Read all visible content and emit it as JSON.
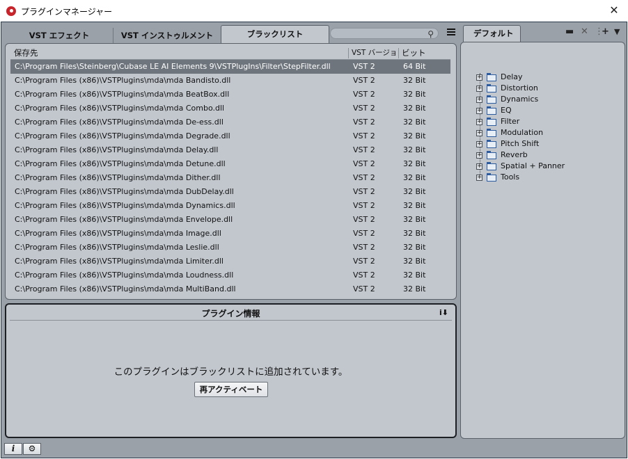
{
  "window": {
    "title": "プラグインマネージャー",
    "close_icon": "close-icon"
  },
  "tabs": [
    {
      "label": "VST エフェクト",
      "active": false
    },
    {
      "label": "VST インストゥルメント",
      "active": false
    },
    {
      "label": "ブラックリスト",
      "active": true
    }
  ],
  "search": {
    "placeholder": "",
    "icon": "search-icon"
  },
  "list": {
    "columns": [
      "保存先",
      "VST バージョン",
      "ビット"
    ],
    "rows": [
      {
        "path": "C:\\Program Files\\Steinberg\\Cubase LE AI Elements 9\\VSTPlugIns\\Filter\\StepFilter.dll",
        "vst": "VST 2",
        "bit": "64 Bit",
        "selected": true
      },
      {
        "path": "C:\\Program Files (x86)\\VSTPlugins\\mda\\mda Bandisto.dll",
        "vst": "VST 2",
        "bit": "32 Bit"
      },
      {
        "path": "C:\\Program Files (x86)\\VSTPlugins\\mda\\mda BeatBox.dll",
        "vst": "VST 2",
        "bit": "32 Bit"
      },
      {
        "path": "C:\\Program Files (x86)\\VSTPlugins\\mda\\mda Combo.dll",
        "vst": "VST 2",
        "bit": "32 Bit"
      },
      {
        "path": "C:\\Program Files (x86)\\VSTPlugins\\mda\\mda De-ess.dll",
        "vst": "VST 2",
        "bit": "32 Bit"
      },
      {
        "path": "C:\\Program Files (x86)\\VSTPlugins\\mda\\mda Degrade.dll",
        "vst": "VST 2",
        "bit": "32 Bit"
      },
      {
        "path": "C:\\Program Files (x86)\\VSTPlugins\\mda\\mda Delay.dll",
        "vst": "VST 2",
        "bit": "32 Bit"
      },
      {
        "path": "C:\\Program Files (x86)\\VSTPlugins\\mda\\mda Detune.dll",
        "vst": "VST 2",
        "bit": "32 Bit"
      },
      {
        "path": "C:\\Program Files (x86)\\VSTPlugins\\mda\\mda Dither.dll",
        "vst": "VST 2",
        "bit": "32 Bit"
      },
      {
        "path": "C:\\Program Files (x86)\\VSTPlugins\\mda\\mda DubDelay.dll",
        "vst": "VST 2",
        "bit": "32 Bit"
      },
      {
        "path": "C:\\Program Files (x86)\\VSTPlugins\\mda\\mda Dynamics.dll",
        "vst": "VST 2",
        "bit": "32 Bit"
      },
      {
        "path": "C:\\Program Files (x86)\\VSTPlugins\\mda\\mda Envelope.dll",
        "vst": "VST 2",
        "bit": "32 Bit"
      },
      {
        "path": "C:\\Program Files (x86)\\VSTPlugins\\mda\\mda Image.dll",
        "vst": "VST 2",
        "bit": "32 Bit"
      },
      {
        "path": "C:\\Program Files (x86)\\VSTPlugins\\mda\\mda Leslie.dll",
        "vst": "VST 2",
        "bit": "32 Bit"
      },
      {
        "path": "C:\\Program Files (x86)\\VSTPlugins\\mda\\mda Limiter.dll",
        "vst": "VST 2",
        "bit": "32 Bit"
      },
      {
        "path": "C:\\Program Files (x86)\\VSTPlugins\\mda\\mda Loudness.dll",
        "vst": "VST 2",
        "bit": "32 Bit"
      },
      {
        "path": "C:\\Program Files (x86)\\VSTPlugins\\mda\\mda MultiBand.dll",
        "vst": "VST 2",
        "bit": "32 Bit"
      }
    ]
  },
  "info": {
    "title": "プラグイン情報",
    "message": "このプラグインはブラックリストに追加されています。",
    "reactivate_label": "再アクティベート",
    "export_icon": "info-export-icon"
  },
  "collections": {
    "tab_label": "デフォルト",
    "tools": [
      "folder-icon",
      "delete-icon",
      "add-icon",
      "dropdown-icon"
    ],
    "items": [
      "Delay",
      "Distortion",
      "Dynamics",
      "EQ",
      "Filter",
      "Modulation",
      "Pitch Shift",
      "Reverb",
      "Spatial + Panner",
      "Tools"
    ]
  },
  "bottom": {
    "info_button_icon": "info-icon",
    "settings_button_icon": "gear-icon"
  },
  "colors": {
    "panel": "#c2c7ce",
    "frame": "#9ba1a9",
    "selection": "#6e757d",
    "logo": "#c8242b"
  }
}
